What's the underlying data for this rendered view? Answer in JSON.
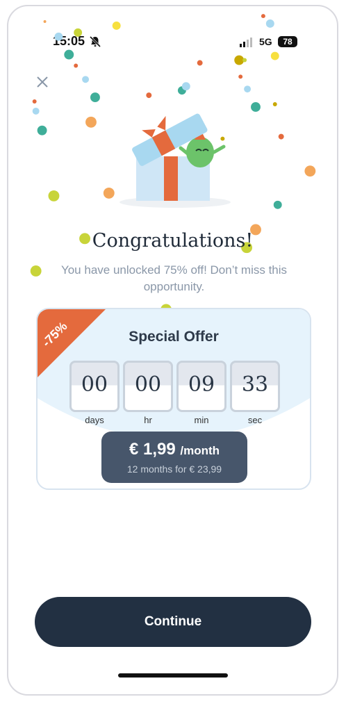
{
  "status_bar": {
    "time": "15:05",
    "network": "5G",
    "battery": "78",
    "bell_icon": "bell-slash-icon",
    "signal_icon": "signal-icon"
  },
  "dialog": {
    "close_icon": "close-icon",
    "gift_icon": "gift-box-illustration",
    "title": "Congratulations!",
    "subtitle": "You have unlocked 75% off! Don’t miss this opportunity."
  },
  "offer": {
    "discount": "-75%",
    "title": "Special Offer",
    "countdown": [
      {
        "value": "00",
        "unit": "days"
      },
      {
        "value": "00",
        "unit": "hr"
      },
      {
        "value": "09",
        "unit": "min"
      },
      {
        "value": "33",
        "unit": "sec"
      }
    ],
    "price": "€ 1,99",
    "price_period": "/month",
    "price_detail": "12 months for € 23,99"
  },
  "actions": {
    "continue": "Continue"
  },
  "colors": {
    "primary_dark": "#223042",
    "accent_orange": "#e46a3d",
    "price_box": "#47566b"
  }
}
